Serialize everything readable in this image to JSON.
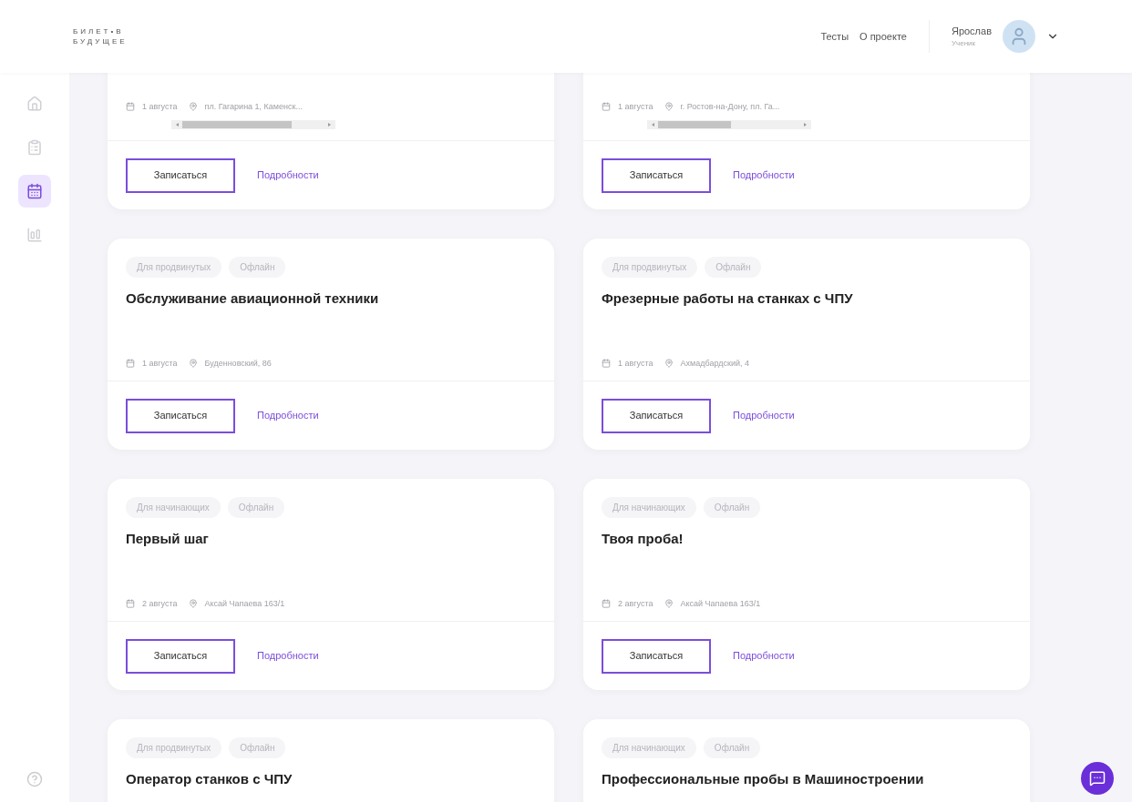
{
  "header": {
    "logo": [
      "БИЛЕТ•В",
      "БУДУЩЕЕ"
    ],
    "nav": [
      "Тесты",
      "О проекте"
    ],
    "user": {
      "name": "Ярослав",
      "role": "Ученик"
    }
  },
  "sidebar": {
    "items": [
      {
        "kind": "home",
        "selected": false
      },
      {
        "kind": "tests",
        "selected": false
      },
      {
        "kind": "calendar",
        "selected": true
      },
      {
        "kind": "stats",
        "selected": false
      }
    ]
  },
  "cards": [
    {
      "date": "1 августа",
      "location": "пл. Гагарина 1, Каменск...",
      "has_scrollbar": true,
      "button": "Записаться",
      "link": "Подробности"
    },
    {
      "date": "1 августа",
      "location": "г. Ростов-на-Дону, пл. Га...",
      "has_scrollbar": true,
      "button": "Записаться",
      "link": "Подробности"
    },
    {
      "tags": [
        "Для продвинутых",
        "Офлайн"
      ],
      "title": "Обслуживание авиационной техники",
      "date": "1 августа",
      "location": "Буденновский, 86",
      "has_scrollbar": false,
      "button": "Записаться",
      "link": "Подробности"
    },
    {
      "tags": [
        "Для продвинутых",
        "Офлайн"
      ],
      "title": "Фрезерные работы на станках с ЧПУ",
      "date": "1 августа",
      "location": "Ахмадбардский, 4",
      "has_scrollbar": false,
      "button": "Записаться",
      "link": "Подробности"
    },
    {
      "tags": [
        "Для начинающих",
        "Офлайн"
      ],
      "title": "Первый шаг",
      "date": "2 августа",
      "location": "Аксай Чапаева 163/1",
      "has_scrollbar": false,
      "button": "Записаться",
      "link": "Подробности"
    },
    {
      "tags": [
        "Для начинающих",
        "Офлайн"
      ],
      "title": "Твоя проба!",
      "date": "2 августа",
      "location": "Аксай Чапаева 163/1",
      "has_scrollbar": false,
      "button": "Записаться",
      "link": "Подробности"
    },
    {
      "tags": [
        "Для продвинутых",
        "Офлайн"
      ],
      "title": "Оператор станков с ЧПУ"
    },
    {
      "tags": [
        "Для начинающих",
        "Офлайн"
      ],
      "title": "Профессиональные пробы в Машиностроении"
    }
  ]
}
